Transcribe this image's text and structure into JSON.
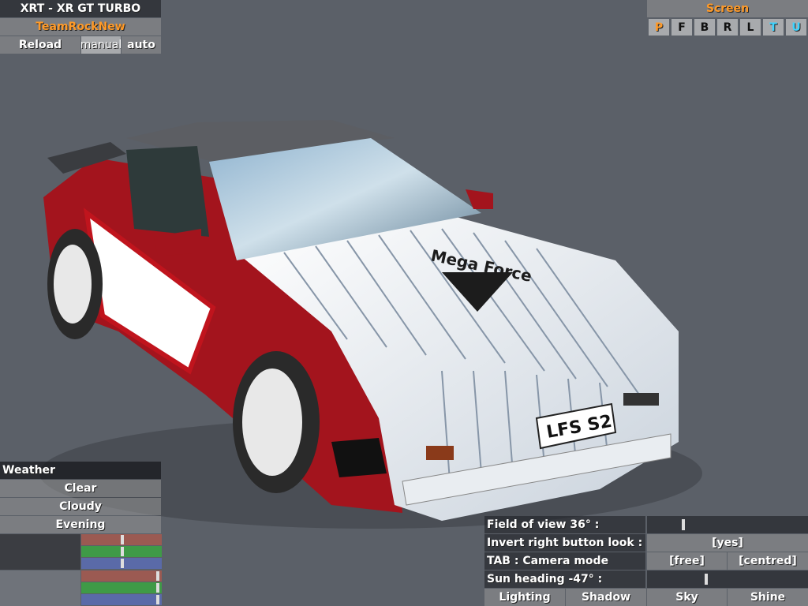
{
  "car": {
    "title": "XRT - XR GT TURBO",
    "skin": "TeamRockNew",
    "reload": "Reload",
    "manual": "manual",
    "auto": "auto",
    "plate": "LFS S2"
  },
  "screen": {
    "title": "Screen",
    "buttons": [
      "P",
      "F",
      "B",
      "R",
      "L",
      "T",
      "U"
    ]
  },
  "weather": {
    "title": "Weather",
    "options": [
      "Clear",
      "Cloudy",
      "Evening"
    ],
    "colors": [
      "#9b5a52",
      "#3f9a47",
      "#5a6aa8",
      "#9b5a52",
      "#3f9a47",
      "#5a6aa8"
    ]
  },
  "settings": {
    "fov_label": "Field of view 36° :",
    "invert_label": "Invert right button look :",
    "invert_value": "[yes]",
    "tab_label": "TAB : Camera mode",
    "free": "[free]",
    "centred": "[centred]",
    "sun_label": "Sun heading -47° :",
    "fov_value": 36,
    "sun_heading": -47
  },
  "bottom_tabs": [
    "Lighting",
    "Shadow",
    "Sky",
    "Shine"
  ]
}
